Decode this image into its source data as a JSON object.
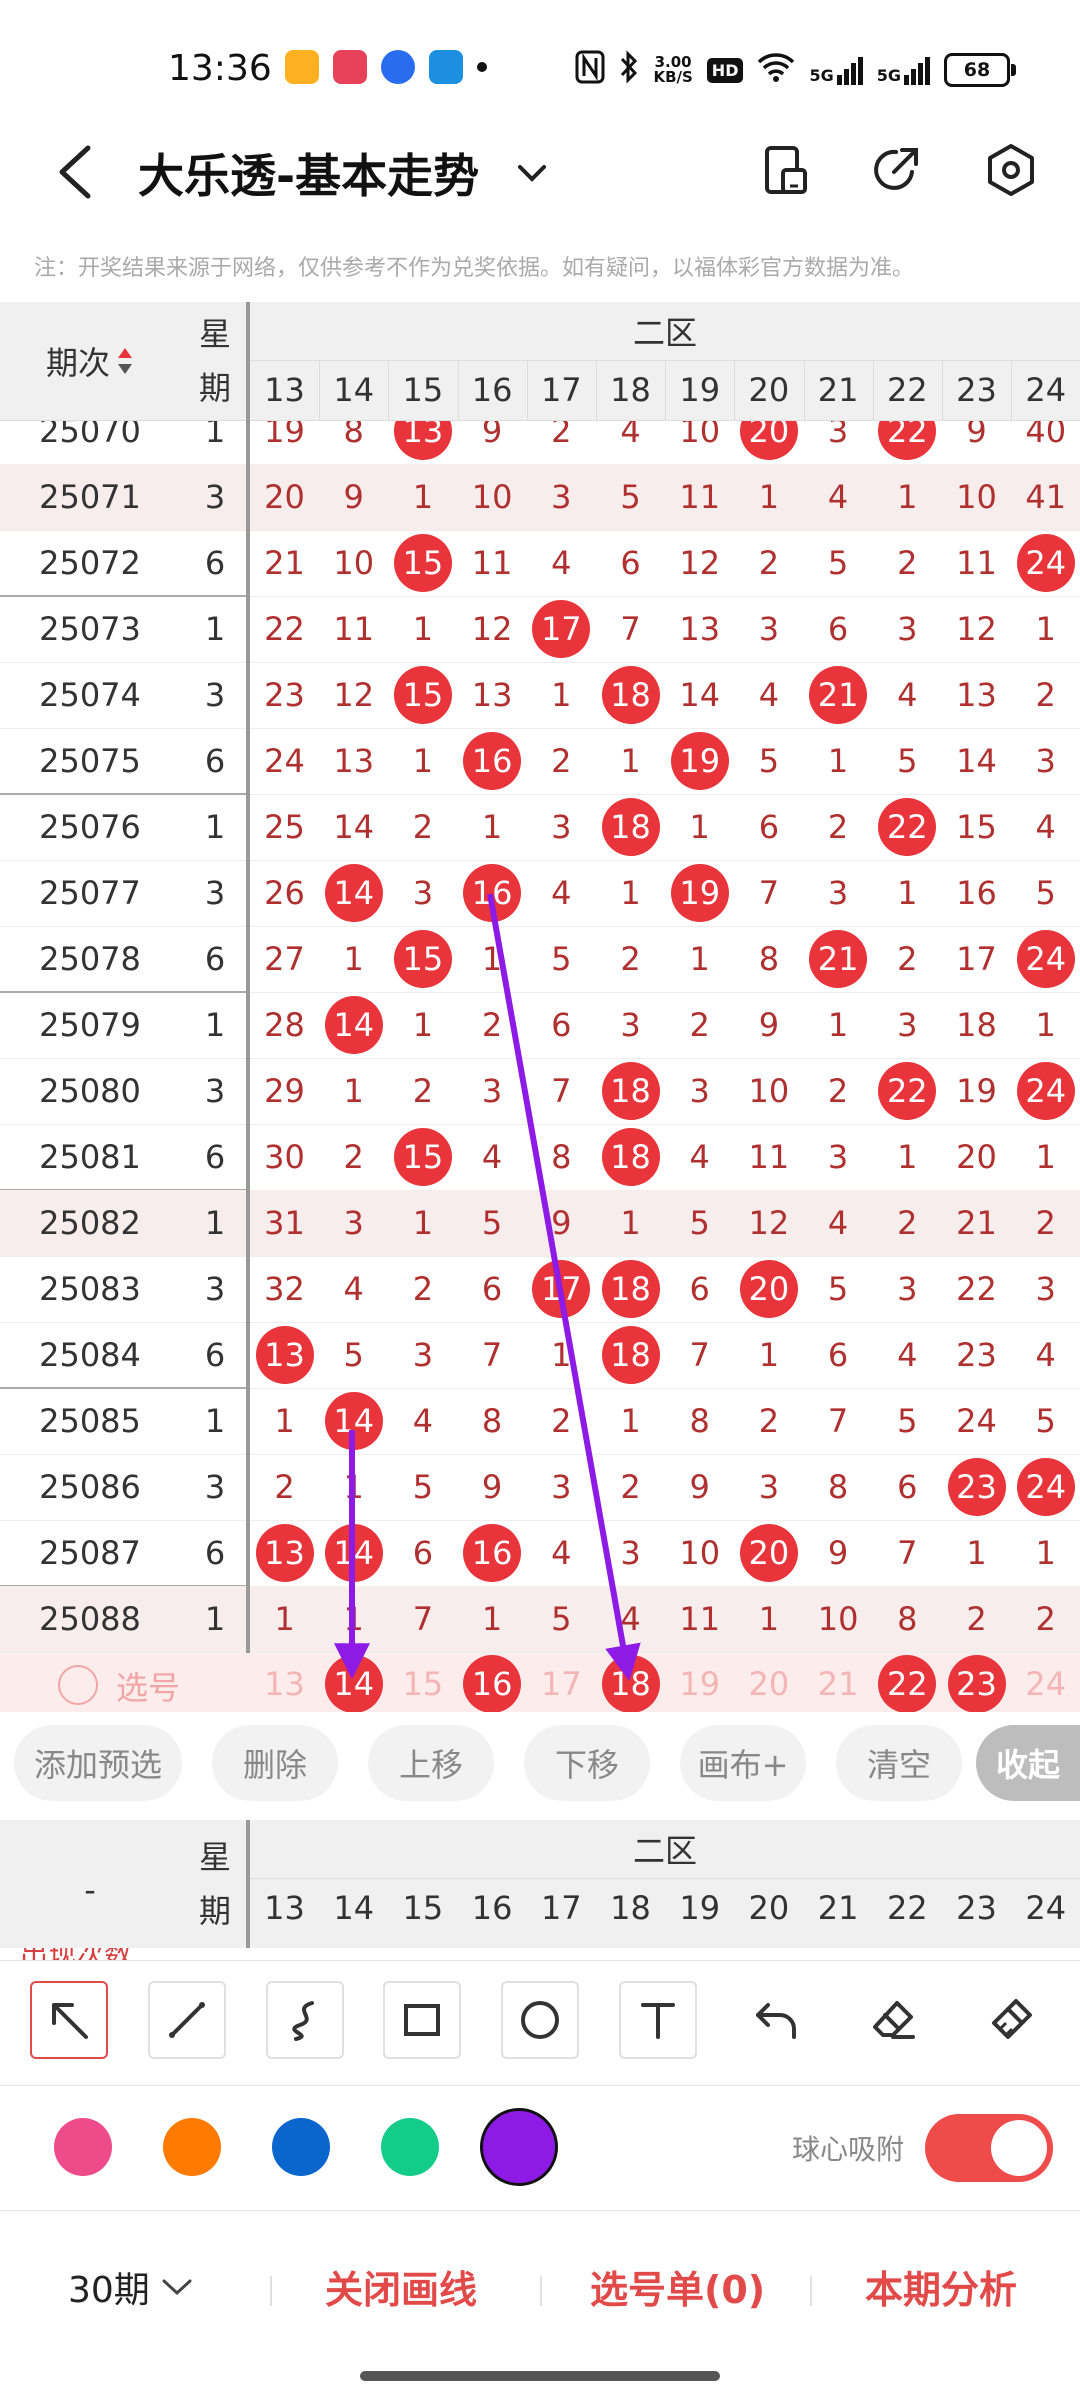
{
  "status_bar": {
    "time": "13:36",
    "speed": "3.00",
    "speed_unit": "KB/S",
    "hd": "HD",
    "net1": "5G",
    "net2": "5G",
    "battery": "68"
  },
  "header": {
    "title": "大乐透-基本走势",
    "icons": [
      "back-icon",
      "chevron-down-icon",
      "device-icon",
      "share-icon",
      "settings-hexagon-icon"
    ]
  },
  "notice": "注：开奖结果来源于网络，仅供参考不作为兑奖依据。如有疑问，以福体彩官方数据为准。",
  "grid": {
    "col_period": "期次",
    "col_week_line1": "星",
    "col_week_line2": "期",
    "zone": "二区",
    "numbers": [
      "13",
      "14",
      "15",
      "16",
      "17",
      "18",
      "19",
      "20",
      "21",
      "22",
      "23",
      "24"
    ],
    "rows": [
      {
        "period": "25070",
        "week": "1",
        "cells": [
          "19",
          "8",
          "13",
          "9",
          "2",
          "4",
          "10",
          "20",
          "3",
          "22",
          "9",
          "40"
        ],
        "hits": [
          2,
          7,
          9
        ],
        "shade": false
      },
      {
        "period": "25071",
        "week": "3",
        "cells": [
          "20",
          "9",
          "1",
          "10",
          "3",
          "5",
          "11",
          "1",
          "4",
          "1",
          "10",
          "41"
        ],
        "hits": [],
        "shade": true
      },
      {
        "period": "25072",
        "week": "6",
        "cells": [
          "21",
          "10",
          "15",
          "11",
          "4",
          "6",
          "12",
          "2",
          "5",
          "2",
          "11",
          "24"
        ],
        "hits": [
          2,
          11
        ],
        "shade": false
      },
      {
        "period": "25073",
        "week": "1",
        "cells": [
          "22",
          "11",
          "1",
          "12",
          "17",
          "7",
          "13",
          "3",
          "6",
          "3",
          "12",
          "1"
        ],
        "hits": [
          4
        ],
        "shade": false
      },
      {
        "period": "25074",
        "week": "3",
        "cells": [
          "23",
          "12",
          "15",
          "13",
          "1",
          "18",
          "14",
          "4",
          "21",
          "4",
          "13",
          "2"
        ],
        "hits": [
          2,
          5,
          8
        ],
        "shade": false
      },
      {
        "period": "25075",
        "week": "6",
        "cells": [
          "24",
          "13",
          "1",
          "16",
          "2",
          "1",
          "19",
          "5",
          "1",
          "5",
          "14",
          "3"
        ],
        "hits": [
          3,
          6
        ],
        "shade": false
      },
      {
        "period": "25076",
        "week": "1",
        "cells": [
          "25",
          "14",
          "2",
          "1",
          "3",
          "18",
          "1",
          "6",
          "2",
          "22",
          "15",
          "4"
        ],
        "hits": [
          5,
          9
        ],
        "shade": false
      },
      {
        "period": "25077",
        "week": "3",
        "cells": [
          "26",
          "14",
          "3",
          "16",
          "4",
          "1",
          "19",
          "7",
          "3",
          "1",
          "16",
          "5"
        ],
        "hits": [
          1,
          3,
          6
        ],
        "shade": false
      },
      {
        "period": "25078",
        "week": "6",
        "cells": [
          "27",
          "1",
          "15",
          "1",
          "5",
          "2",
          "1",
          "8",
          "21",
          "2",
          "17",
          "24"
        ],
        "hits": [
          2,
          8,
          11
        ],
        "shade": false
      },
      {
        "period": "25079",
        "week": "1",
        "cells": [
          "28",
          "14",
          "1",
          "2",
          "6",
          "3",
          "2",
          "9",
          "1",
          "3",
          "18",
          "1"
        ],
        "hits": [
          1
        ],
        "shade": false
      },
      {
        "period": "25080",
        "week": "3",
        "cells": [
          "29",
          "1",
          "2",
          "3",
          "7",
          "18",
          "3",
          "10",
          "2",
          "22",
          "19",
          "24"
        ],
        "hits": [
          5,
          9,
          11
        ],
        "shade": false
      },
      {
        "period": "25081",
        "week": "6",
        "cells": [
          "30",
          "2",
          "15",
          "4",
          "8",
          "18",
          "4",
          "11",
          "3",
          "1",
          "20",
          "1"
        ],
        "hits": [
          2,
          5
        ],
        "shade": false
      },
      {
        "period": "25082",
        "week": "1",
        "cells": [
          "31",
          "3",
          "1",
          "5",
          "9",
          "1",
          "5",
          "12",
          "4",
          "2",
          "21",
          "2"
        ],
        "hits": [],
        "shade": true
      },
      {
        "period": "25083",
        "week": "3",
        "cells": [
          "32",
          "4",
          "2",
          "6",
          "17",
          "18",
          "6",
          "20",
          "5",
          "3",
          "22",
          "3"
        ],
        "hits": [
          4,
          5,
          7
        ],
        "shade": false
      },
      {
        "period": "25084",
        "week": "6",
        "cells": [
          "13",
          "5",
          "3",
          "7",
          "1",
          "18",
          "7",
          "1",
          "6",
          "4",
          "23",
          "4"
        ],
        "hits": [
          0,
          5
        ],
        "shade": false
      },
      {
        "period": "25085",
        "week": "1",
        "cells": [
          "1",
          "14",
          "4",
          "8",
          "2",
          "1",
          "8",
          "2",
          "7",
          "5",
          "24",
          "5"
        ],
        "hits": [
          1
        ],
        "shade": false
      },
      {
        "period": "25086",
        "week": "3",
        "cells": [
          "2",
          "1",
          "5",
          "9",
          "3",
          "2",
          "9",
          "3",
          "8",
          "6",
          "23",
          "24"
        ],
        "hits": [
          10,
          11
        ],
        "shade": false
      },
      {
        "period": "25087",
        "week": "6",
        "cells": [
          "13",
          "14",
          "6",
          "16",
          "4",
          "3",
          "10",
          "20",
          "9",
          "7",
          "1",
          "1"
        ],
        "hits": [
          0,
          1,
          3,
          7
        ],
        "shade": false
      },
      {
        "period": "25088",
        "week": "1",
        "cells": [
          "1",
          "1",
          "7",
          "1",
          "5",
          "4",
          "11",
          "1",
          "10",
          "8",
          "2",
          "2"
        ],
        "hits": [],
        "shade": true
      }
    ],
    "select_label": "选号",
    "selected_hits": [
      1,
      3,
      5,
      9,
      10
    ]
  },
  "chips": [
    "添加预选",
    "删除",
    "上移",
    "下移",
    "画布+",
    "清空",
    "收起"
  ],
  "summary": {
    "dash": "-",
    "week_line1": "星",
    "week_line2": "期",
    "zone": "二区",
    "numbers": [
      "13",
      "14",
      "15",
      "16",
      "17",
      "18",
      "19",
      "20",
      "21",
      "22",
      "23",
      "24"
    ],
    "peek_label": "出现次数"
  },
  "toolbar": {
    "tools": [
      "arrow-tool-icon",
      "line-tool-icon",
      "curve-tool-icon",
      "rectangle-tool-icon",
      "circle-tool-icon",
      "text-tool-icon",
      "undo-icon",
      "eraser-icon",
      "brush-clear-icon"
    ],
    "active": "arrow-tool-icon"
  },
  "colors": {
    "swatches": [
      "#ee4b8a",
      "#ff7a00",
      "#0a66cc",
      "#13cc8a",
      "#8e1ae6"
    ],
    "selected": "#8e1ae6",
    "snap_label": "球心吸附",
    "snap_on": true,
    "accent": "#e8343a"
  },
  "bottom": {
    "period": "30期",
    "close_draw": "关闭画线",
    "selection_list": "选号单(0)",
    "analysis": "本期分析"
  }
}
